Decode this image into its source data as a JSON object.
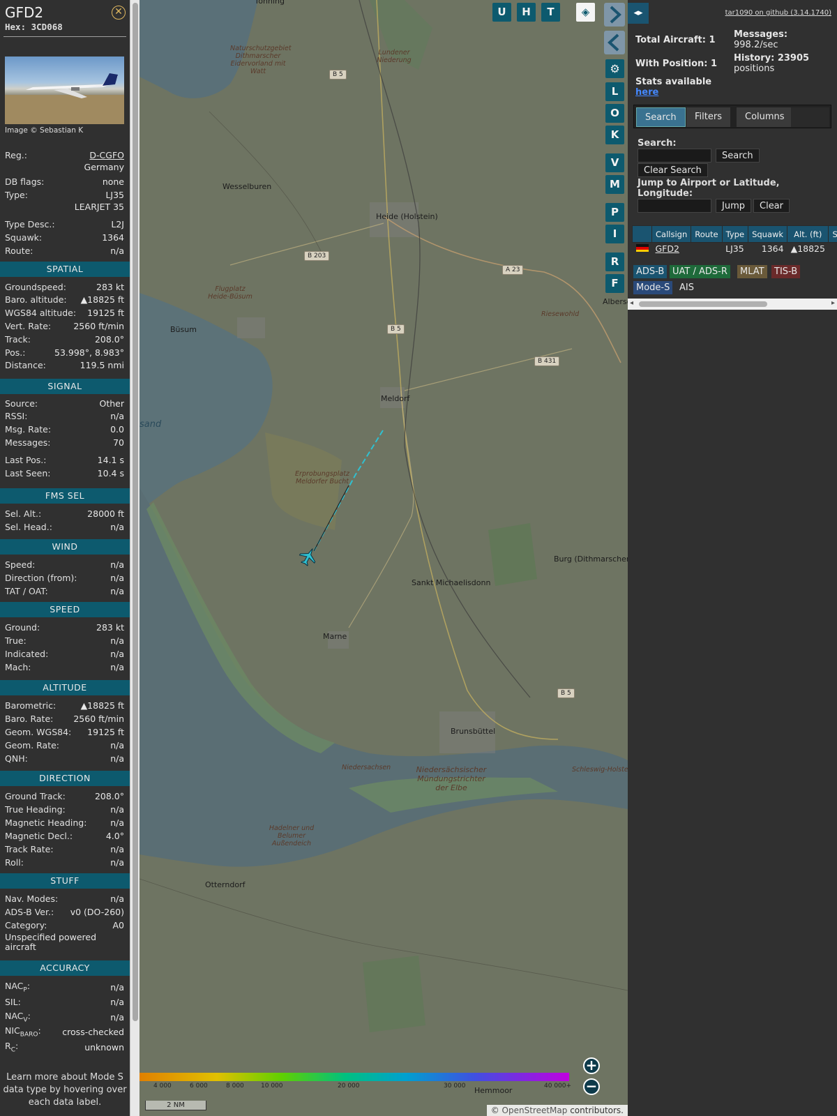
{
  "aircraft": {
    "callsign": "GFD2",
    "hex_label": "Hex: 3CD068",
    "image_credit": "Image © Sebastian K"
  },
  "info_rows": {
    "reg": {
      "label": "Reg.:",
      "value": "D-CGFO"
    },
    "country": "Germany",
    "db_flags": {
      "label": "DB flags:",
      "value": "none"
    },
    "type": {
      "label": "Type:",
      "value": "LJ35"
    },
    "type_name": "LEARJET 35",
    "type_desc": {
      "label": "Type Desc.:",
      "value": "L2J"
    },
    "squawk": {
      "label": "Squawk:",
      "value": "1364"
    },
    "route": {
      "label": "Route:",
      "value": "n/a"
    }
  },
  "sections": {
    "spatial": {
      "title": "SPATIAL",
      "rows": [
        {
          "label": "Groundspeed:",
          "value": "283 kt"
        },
        {
          "label": "Baro. altitude:",
          "value": "▲18825 ft"
        },
        {
          "label": "WGS84 altitude:",
          "value": "19125 ft"
        },
        {
          "label": "Vert. Rate:",
          "value": "2560 ft/min"
        },
        {
          "label": "Track:",
          "value": "208.0°"
        },
        {
          "label": "Pos.:",
          "value": "53.998°, 8.983°"
        },
        {
          "label": "Distance:",
          "value": "119.5 nmi"
        }
      ]
    },
    "signal": {
      "title": "SIGNAL",
      "rows": [
        {
          "label": "Source:",
          "value": "Other"
        },
        {
          "label": "RSSI:",
          "value": "n/a"
        },
        {
          "label": "Msg. Rate:",
          "value": "0.0"
        },
        {
          "label": "Messages:",
          "value": "70"
        },
        {
          "label": "Last Pos.:",
          "value": "14.1 s"
        },
        {
          "label": "Last Seen:",
          "value": "10.4 s"
        }
      ]
    },
    "fms": {
      "title": "FMS SEL",
      "rows": [
        {
          "label": "Sel. Alt.:",
          "value": "28000 ft"
        },
        {
          "label": "Sel. Head.:",
          "value": "n/a"
        }
      ]
    },
    "wind": {
      "title": "WIND",
      "rows": [
        {
          "label": "Speed:",
          "value": "n/a"
        },
        {
          "label": "Direction (from):",
          "value": "n/a"
        },
        {
          "label": "TAT / OAT:",
          "value": "n/a"
        }
      ]
    },
    "speed": {
      "title": "SPEED",
      "rows": [
        {
          "label": "Ground:",
          "value": "283 kt"
        },
        {
          "label": "True:",
          "value": "n/a"
        },
        {
          "label": "Indicated:",
          "value": "n/a"
        },
        {
          "label": "Mach:",
          "value": "n/a"
        }
      ]
    },
    "altitude": {
      "title": "ALTITUDE",
      "rows": [
        {
          "label": "Barometric:",
          "value": "▲18825 ft"
        },
        {
          "label": "Baro. Rate:",
          "value": "2560 ft/min"
        },
        {
          "label": "Geom. WGS84:",
          "value": "19125 ft"
        },
        {
          "label": "Geom. Rate:",
          "value": "n/a"
        },
        {
          "label": "QNH:",
          "value": "n/a"
        }
      ]
    },
    "direction": {
      "title": "DIRECTION",
      "rows": [
        {
          "label": "Ground Track:",
          "value": "208.0°"
        },
        {
          "label": "True Heading:",
          "value": "n/a"
        },
        {
          "label": "Magnetic Heading:",
          "value": "n/a"
        },
        {
          "label": "Magnetic Decl.:",
          "value": "4.0°"
        },
        {
          "label": "Track Rate:",
          "value": "n/a"
        },
        {
          "label": "Roll:",
          "value": "n/a"
        }
      ]
    },
    "stuff": {
      "title": "STUFF",
      "rows": [
        {
          "label": "Nav. Modes:",
          "value": "n/a"
        },
        {
          "label": "ADS-B Ver.:",
          "value": "v0 (DO-260)"
        },
        {
          "label": "Category:",
          "value": "A0"
        }
      ],
      "category_desc": "Unspecified powered aircraft"
    },
    "accuracy": {
      "title": "ACCURACY",
      "rows": [
        {
          "label": "NAC",
          "sub": "P",
          "value": "n/a"
        },
        {
          "label": "SIL:",
          "sub": "",
          "value": "n/a"
        },
        {
          "label": "NAC",
          "sub": "V",
          "value": "n/a"
        },
        {
          "label": "NIC",
          "sub": "BARO",
          "value": "cross-checked"
        },
        {
          "label": "R",
          "sub": "C",
          "value": "unknown"
        }
      ]
    }
  },
  "info_note": "Learn more about Mode S data type by hovering over each data label.",
  "map": {
    "buttons": [
      "U",
      "H",
      "T"
    ],
    "side_buttons": [
      "L",
      "O",
      "K",
      "V",
      "M",
      "P",
      "I",
      "R",
      "F"
    ],
    "places": [
      {
        "name": "Wesselburen"
      },
      {
        "name": "Heide (Holstein)"
      },
      {
        "name": "Büsum"
      },
      {
        "name": "Meldorf"
      },
      {
        "name": "Sankt Michaelisdonn"
      },
      {
        "name": "Burg (Dithmarschen)"
      },
      {
        "name": "Marne"
      },
      {
        "name": "Brunsbüttel"
      },
      {
        "name": "Otterndorf"
      },
      {
        "name": "Hemmoor"
      },
      {
        "name": "Riesewohld"
      },
      {
        "name": "Albersd"
      },
      {
        "name": "Tönning"
      }
    ],
    "italic_labels": [
      "Naturschutzgebiet Dithmarscher Eidervorland mit Watt",
      "Lundener Niederung",
      "Flugplatz Heide-Büsum",
      "Erprobungsplatz Meldorfer Bucht",
      "Niedersächsischer Mündungstrichter der Elbe",
      "Hadelner und Belumer Außendeich",
      "Niedersachsen",
      "Schleswig-Holstein"
    ],
    "roads": [
      "B 5",
      "B 203",
      "B 5",
      "A 23",
      "B 431",
      "B 5"
    ],
    "water_label": "sand",
    "alt_ticks": [
      "4 000",
      "6 000",
      "8 000",
      "10 000",
      "20 000",
      "30 000",
      "40 000+"
    ],
    "scale": "2 NM",
    "attribution_prefix": "© ",
    "attribution_link": "OpenStreetMap",
    "attribution_suffix": " contributors."
  },
  "right": {
    "github": "tar1090 on github (3.14.1740)",
    "total_aircraft": "Total Aircraft: 1",
    "with_position": "With Position: 1",
    "messages_label": "Messages:",
    "messages_value": "998.2/sec",
    "history_label": "History: 23905",
    "history_value": "positions",
    "stats_text": "Stats available",
    "stats_link": "here",
    "tabs": [
      "Search",
      "Filters",
      "Columns"
    ],
    "search_label": "Search:",
    "search_btn": "Search",
    "clear_search_btn": "Clear Search",
    "jump_label": "Jump to Airport or Latitude, Longitude:",
    "jump_btn": "Jump",
    "clear_btn": "Clear",
    "table": {
      "headers": [
        "Callsign",
        "Route",
        "Type",
        "Squawk",
        "Alt. (ft)",
        "Spd"
      ],
      "row": {
        "callsign": "GFD2",
        "route": "",
        "type": "LJ35",
        "squawk": "1364",
        "alt": "▲18825"
      }
    },
    "tags": [
      "ADS-B",
      "UAT / ADS-R",
      "MLAT",
      "TIS-B",
      "Mode-S",
      "AIS"
    ]
  }
}
